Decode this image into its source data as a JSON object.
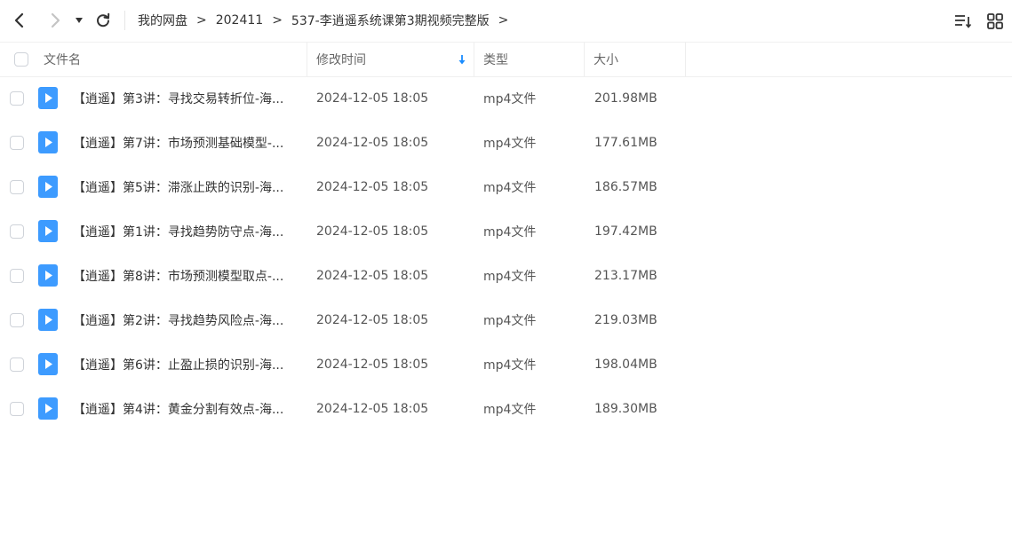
{
  "breadcrumb": {
    "items": [
      "我的网盘",
      "202411",
      "537-李逍遥系统课第3期视频完整版"
    ],
    "separator": ">"
  },
  "columns": {
    "name": "文件名",
    "modified": "修改时间",
    "type": "类型",
    "size": "大小"
  },
  "accent_color": "#1a8cff",
  "file_icon_color": "#3d9bff",
  "files": [
    {
      "name": "【逍遥】第3讲：寻找交易转折位-海...",
      "modified": "2024-12-05 18:05",
      "type": "mp4文件",
      "size": "201.98MB"
    },
    {
      "name": "【逍遥】第7讲：市场预测基础模型-...",
      "modified": "2024-12-05 18:05",
      "type": "mp4文件",
      "size": "177.61MB"
    },
    {
      "name": "【逍遥】第5讲：滞涨止跌的识别-海...",
      "modified": "2024-12-05 18:05",
      "type": "mp4文件",
      "size": "186.57MB"
    },
    {
      "name": "【逍遥】第1讲：寻找趋势防守点-海...",
      "modified": "2024-12-05 18:05",
      "type": "mp4文件",
      "size": "197.42MB"
    },
    {
      "name": "【逍遥】第8讲：市场预测模型取点-...",
      "modified": "2024-12-05 18:05",
      "type": "mp4文件",
      "size": "213.17MB"
    },
    {
      "name": "【逍遥】第2讲：寻找趋势风险点-海...",
      "modified": "2024-12-05 18:05",
      "type": "mp4文件",
      "size": "219.03MB"
    },
    {
      "name": "【逍遥】第6讲：止盈止损的识别-海...",
      "modified": "2024-12-05 18:05",
      "type": "mp4文件",
      "size": "198.04MB"
    },
    {
      "name": "【逍遥】第4讲：黄金分割有效点-海...",
      "modified": "2024-12-05 18:05",
      "type": "mp4文件",
      "size": "189.30MB"
    }
  ]
}
